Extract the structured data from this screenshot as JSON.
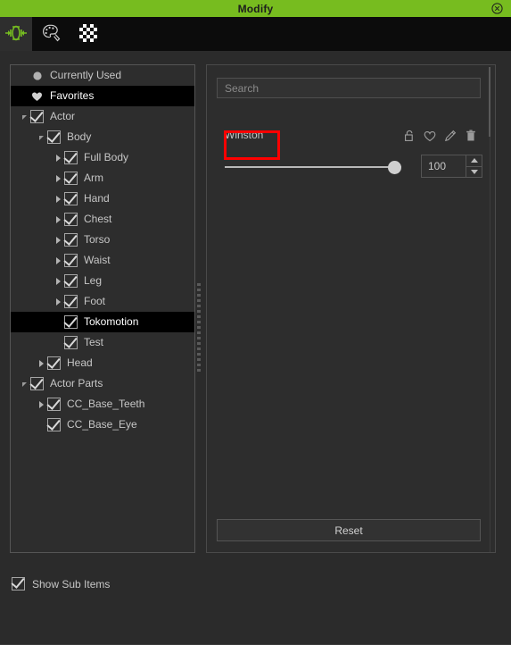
{
  "window": {
    "title": "Modify",
    "close_icon": "close-circle-icon"
  },
  "toolbar": {
    "items": [
      {
        "name": "morph-tool",
        "icon": "morph-arrows-icon",
        "active": true
      },
      {
        "name": "palette-tool",
        "icon": "palette-icon",
        "active": false
      },
      {
        "name": "texture-tool",
        "icon": "checkerboard-icon",
        "active": false
      }
    ]
  },
  "tree": {
    "items": [
      {
        "label": "Currently Used",
        "indent": 0,
        "arrow": "none",
        "icon": "clock-dot-icon",
        "checkbox": false,
        "selected": false
      },
      {
        "label": "Favorites",
        "indent": 0,
        "arrow": "none",
        "icon": "heart-icon",
        "checkbox": false,
        "selected": true
      },
      {
        "label": "Actor",
        "indent": 0,
        "arrow": "expanded",
        "checkbox": true,
        "checked": true,
        "selected": false
      },
      {
        "label": "Body",
        "indent": 1,
        "arrow": "expanded",
        "checkbox": true,
        "checked": true,
        "selected": false
      },
      {
        "label": "Full Body",
        "indent": 2,
        "arrow": "collapsed",
        "checkbox": true,
        "checked": true,
        "selected": false
      },
      {
        "label": "Arm",
        "indent": 2,
        "arrow": "collapsed",
        "checkbox": true,
        "checked": true,
        "selected": false
      },
      {
        "label": "Hand",
        "indent": 2,
        "arrow": "collapsed",
        "checkbox": true,
        "checked": true,
        "selected": false
      },
      {
        "label": "Chest",
        "indent": 2,
        "arrow": "collapsed",
        "checkbox": true,
        "checked": true,
        "selected": false
      },
      {
        "label": "Torso",
        "indent": 2,
        "arrow": "collapsed",
        "checkbox": true,
        "checked": true,
        "selected": false
      },
      {
        "label": "Waist",
        "indent": 2,
        "arrow": "collapsed",
        "checkbox": true,
        "checked": true,
        "selected": false
      },
      {
        "label": "Leg",
        "indent": 2,
        "arrow": "collapsed",
        "checkbox": true,
        "checked": true,
        "selected": false
      },
      {
        "label": "Foot",
        "indent": 2,
        "arrow": "collapsed",
        "checkbox": true,
        "checked": true,
        "selected": false
      },
      {
        "label": "Tokomotion",
        "indent": 2,
        "arrow": "none",
        "checkbox": true,
        "checked": true,
        "selected": true
      },
      {
        "label": "Test",
        "indent": 2,
        "arrow": "none",
        "checkbox": true,
        "checked": true,
        "selected": false
      },
      {
        "label": "Head",
        "indent": 1,
        "arrow": "collapsed",
        "checkbox": true,
        "checked": true,
        "selected": false
      },
      {
        "label": "Actor Parts",
        "indent": 0,
        "arrow": "expanded",
        "checkbox": true,
        "checked": true,
        "selected": false
      },
      {
        "label": "CC_Base_Teeth",
        "indent": 1,
        "arrow": "collapsed",
        "checkbox": true,
        "checked": true,
        "selected": false
      },
      {
        "label": "CC_Base_Eye",
        "indent": 1,
        "arrow": "none",
        "checkbox": true,
        "checked": true,
        "selected": false
      }
    ]
  },
  "right_panel": {
    "search": {
      "placeholder": "Search",
      "value": ""
    },
    "property": {
      "name": "Winston",
      "highlighted": true,
      "highlight_color": "#ff0000",
      "icons": [
        {
          "name": "unlock-icon",
          "glyph": "unlock"
        },
        {
          "name": "favorite-heart-icon",
          "glyph": "heart"
        },
        {
          "name": "edit-pencil-icon",
          "glyph": "pencil"
        },
        {
          "name": "delete-trash-icon",
          "glyph": "trash"
        }
      ],
      "slider": {
        "value": 100,
        "min": 0,
        "max": 100,
        "percent": 100
      },
      "spinner_value": "100"
    },
    "reset_label": "Reset"
  },
  "footer": {
    "show_sub_items_label": "Show Sub Items",
    "show_sub_items_checked": true
  }
}
